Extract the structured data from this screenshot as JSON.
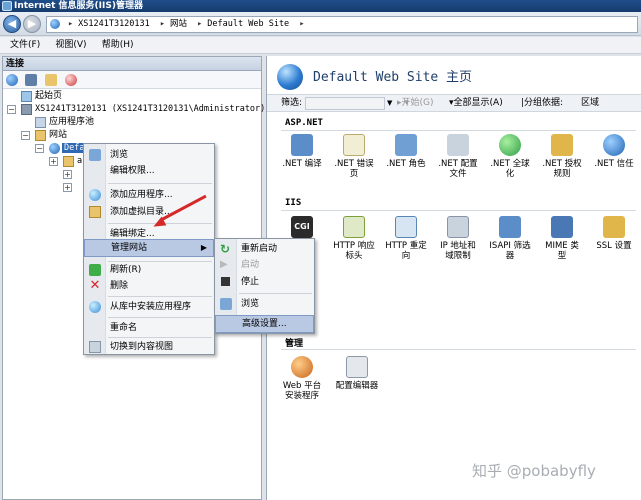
{
  "window": {
    "title": "Internet 信息服务(IIS)管理器"
  },
  "address": {
    "segments": [
      "XS1241T3120131",
      "网站",
      "Default Web Site"
    ],
    "separator": "▸"
  },
  "menubar": {
    "items": [
      "文件(F)",
      "视图(V)",
      "帮助(H)"
    ]
  },
  "connections": {
    "header": "连接",
    "tree": {
      "start_page": "起始页",
      "server": "XS1241T3120131 (XS1241T3120131\\Administrator)",
      "app_pools": "应用程序池",
      "sites": "网站",
      "site": "Default Web Site",
      "child_partial": "a"
    }
  },
  "context_menu": {
    "items": [
      {
        "label": "浏览",
        "icon": "browse-icon"
      },
      {
        "label": "编辑权限...",
        "icon": ""
      },
      {
        "label": "添加应用程序...",
        "icon": "add-app-icon"
      },
      {
        "label": "添加虚拟目录...",
        "icon": "add-vdir-icon"
      },
      {
        "label": "编辑绑定...",
        "icon": ""
      },
      {
        "label": "管理网站",
        "icon": ""
      },
      {
        "label": "刷新(R)",
        "icon": "refresh-icon"
      },
      {
        "label": "删除",
        "icon": "delete-icon"
      },
      {
        "label": "从库中安装应用程序",
        "icon": "install-icon"
      },
      {
        "label": "重命名",
        "icon": ""
      },
      {
        "label": "切换到内容视图",
        "icon": "content-view-icon"
      }
    ]
  },
  "submenu": {
    "items": [
      {
        "label": "重新启动",
        "icon": "restart-icon",
        "enabled": true
      },
      {
        "label": "启动",
        "icon": "start-icon",
        "enabled": false
      },
      {
        "label": "停止",
        "icon": "stop-icon",
        "enabled": true
      },
      {
        "label": "浏览",
        "icon": "browse-icon",
        "enabled": true
      },
      {
        "label": "高级设置...",
        "icon": "",
        "enabled": true
      }
    ]
  },
  "home": {
    "title": "Default Web Site 主页",
    "filter": {
      "label": "筛选:",
      "start": "开始(G)",
      "show_all": "全部显示(A)",
      "group_by": "分组依据:",
      "group_value": "区域"
    },
    "sections": [
      {
        "name": "ASP.NET",
        "features": [
          ".NET 编译",
          ".NET 错误页",
          ".NET 角色",
          ".NET 配置文件",
          ".NET 全球化",
          ".NET 授权规则",
          ".NET 信任"
        ]
      },
      {
        "name": "IIS",
        "features": [
          "CGI",
          "HTTP 响应标头",
          "HTTP 重定向",
          "IP 地址和域限制",
          "ISAPI 筛选器",
          "MIME 类型",
          "SSL 设置"
        ]
      },
      {
        "name": "管理",
        "features": [
          "Web 平台安装程序",
          "配置编辑器"
        ]
      }
    ]
  },
  "watermark": "知乎 @pobabyfly",
  "colors": {
    "accent": "#2f69b4",
    "annotation_arrow": "#d62828",
    "highlight": "#b9c9e4"
  }
}
